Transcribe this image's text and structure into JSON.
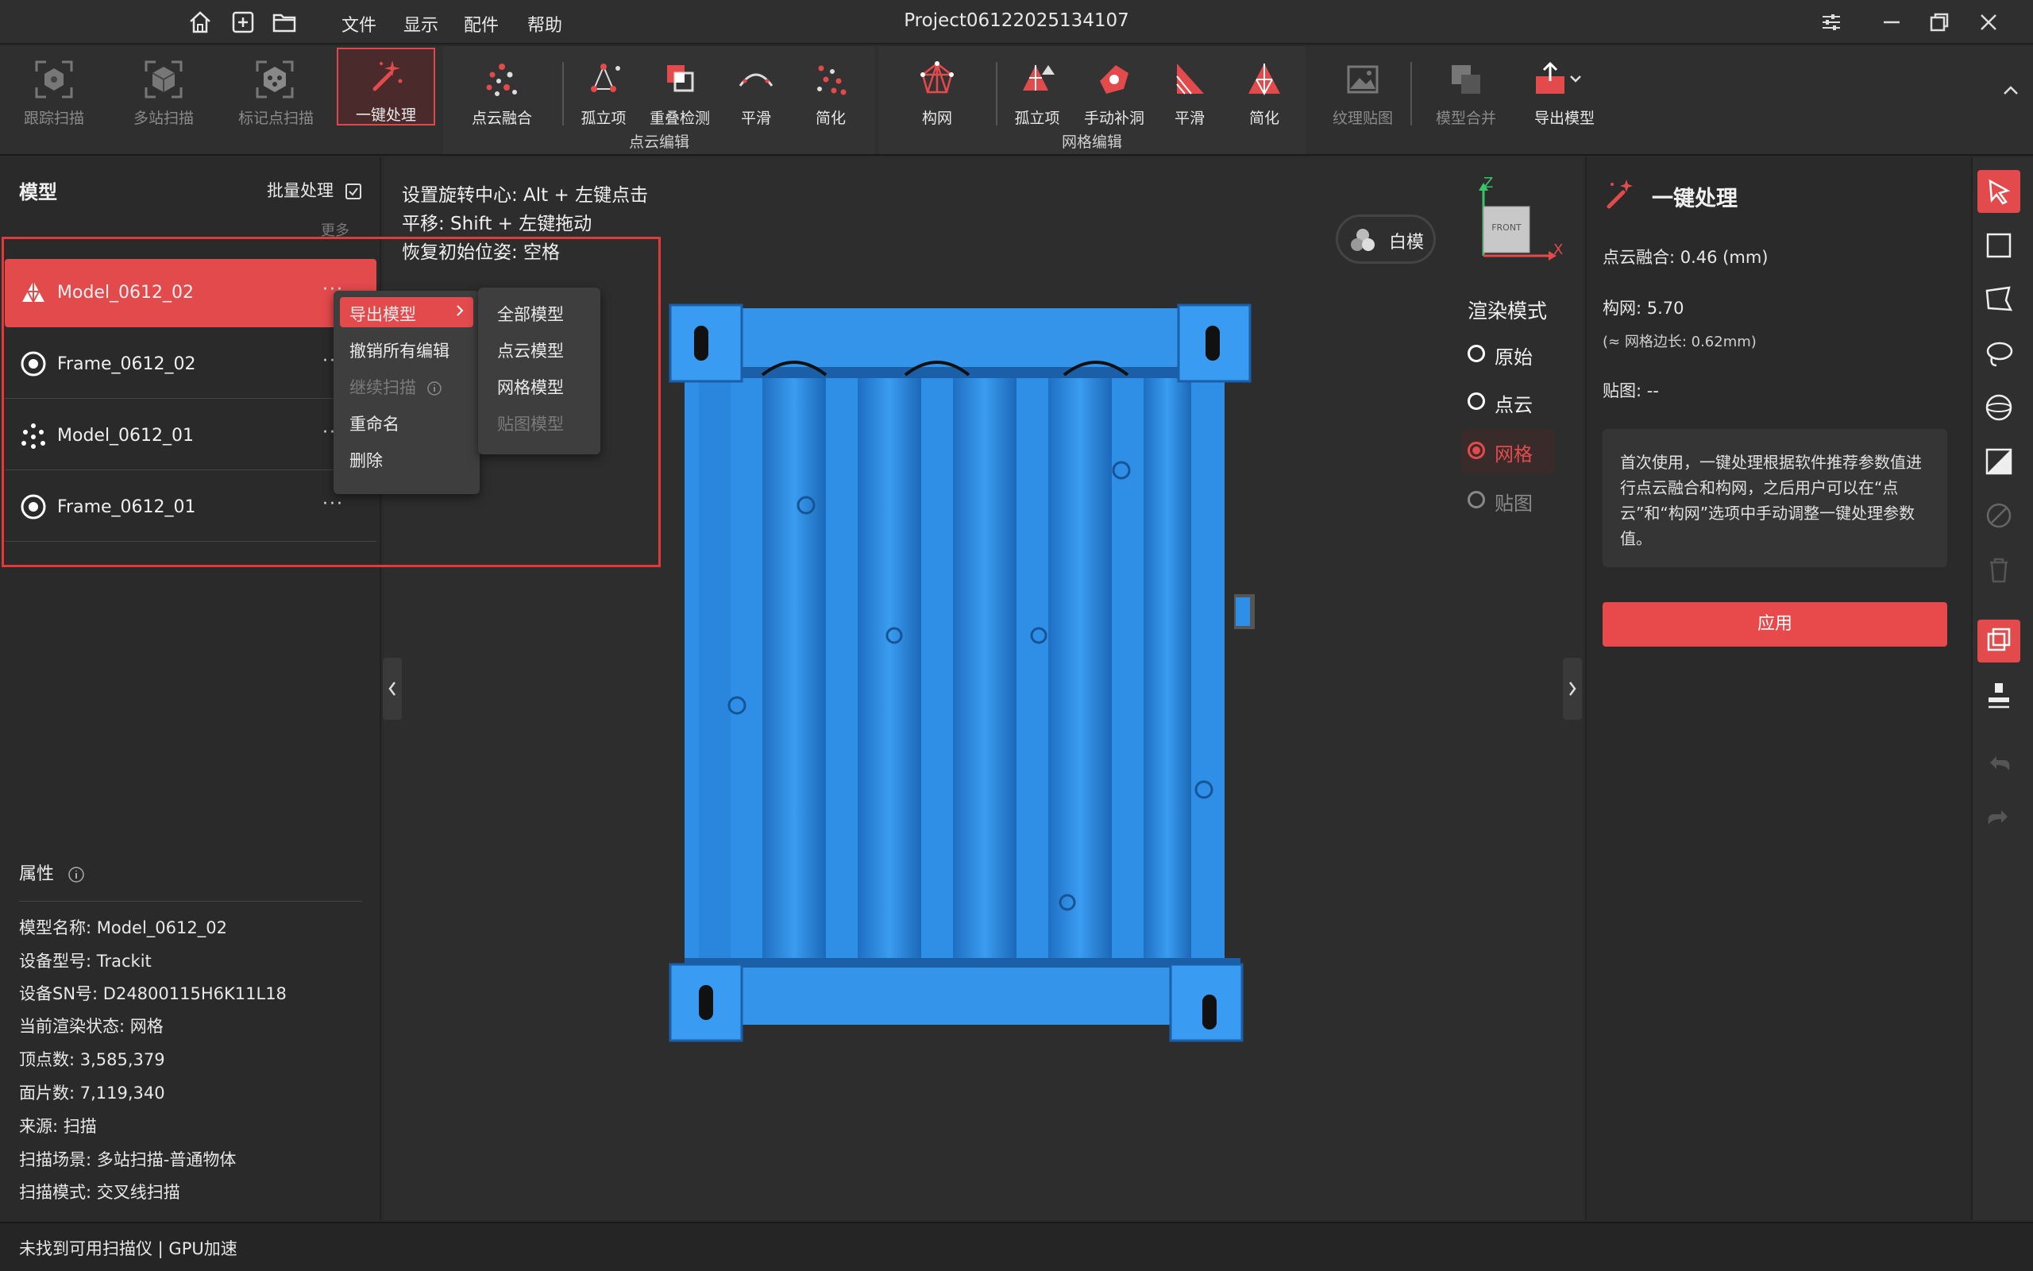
{
  "titlebar": {
    "project_title": "Project06122025134107",
    "menus": [
      "文件",
      "显示",
      "配件",
      "帮助"
    ]
  },
  "ribbon": {
    "scan": [
      {
        "label": "跟踪扫描",
        "icon": "tracking-scan-icon"
      },
      {
        "label": "多站扫描",
        "icon": "multi-station-scan-icon"
      },
      {
        "label": "标记点扫描",
        "icon": "marker-scan-icon"
      }
    ],
    "one_click": {
      "label": "一键处理",
      "icon": "magic-wand-icon"
    },
    "point_cloud_group": {
      "label": "点云编辑",
      "items": [
        {
          "label": "点云融合",
          "icon": "point-fusion-icon"
        },
        {
          "label": "孤立项",
          "icon": "isolated-icon"
        },
        {
          "label": "重叠检测",
          "icon": "overlap-detect-icon"
        },
        {
          "label": "平滑",
          "icon": "smooth-icon"
        },
        {
          "label": "简化",
          "icon": "simplify-icon"
        }
      ]
    },
    "mesh_group": {
      "label": "网格编辑",
      "items": [
        {
          "label": "构网",
          "icon": "mesh-build-icon"
        },
        {
          "label": "孤立项",
          "icon": "mesh-isolated-icon"
        },
        {
          "label": "手动补洞",
          "icon": "fill-hole-icon"
        },
        {
          "label": "平滑",
          "icon": "mesh-smooth-icon"
        },
        {
          "label": "简化",
          "icon": "mesh-simplify-icon"
        }
      ]
    },
    "texture": {
      "label": "纹理贴图",
      "icon": "texture-map-icon"
    },
    "merge": {
      "label": "模型合并",
      "icon": "model-merge-icon"
    },
    "export": {
      "label": "导出模型",
      "icon": "export-model-icon"
    }
  },
  "left_panel": {
    "title": "模型",
    "batch_label": "批量处理",
    "more_label": "更多",
    "models": [
      {
        "name": "Model_0612_02",
        "icon": "mesh-model-icon",
        "selected": true
      },
      {
        "name": "Frame_0612_02",
        "icon": "frame-icon",
        "selected": false
      },
      {
        "name": "Model_0612_01",
        "icon": "point-cloud-icon",
        "selected": false
      },
      {
        "name": "Frame_0612_01",
        "icon": "frame-icon",
        "selected": false
      }
    ],
    "more_dots": "···"
  },
  "context_menu": {
    "items": [
      {
        "label": "导出模型",
        "highlighted": true,
        "disabled": false
      },
      {
        "label": "撤销所有编辑",
        "highlighted": false,
        "disabled": false
      },
      {
        "label": "继续扫描",
        "highlighted": false,
        "disabled": true
      },
      {
        "label": "重命名",
        "highlighted": false,
        "disabled": false
      },
      {
        "label": "删除",
        "highlighted": false,
        "disabled": false
      }
    ],
    "submenu": [
      {
        "label": "全部模型",
        "disabled": false
      },
      {
        "label": "点云模型",
        "disabled": false
      },
      {
        "label": "网格模型",
        "disabled": false
      },
      {
        "label": "贴图模型",
        "disabled": true
      }
    ]
  },
  "properties": {
    "title": "属性",
    "rows": [
      "模型名称:  Model_0612_02",
      "设备型号:  Trackit",
      "设备SN号:  D24800115H6K11L18",
      "当前渲染状态:  网格",
      "顶点数:  3,585,379",
      "面片数:  7,119,340",
      "来源:  扫描",
      "扫描场景:  多站扫描-普通物体",
      "扫描模式:  交叉线扫描"
    ]
  },
  "viewport": {
    "hints": [
      "设置旋转中心: Alt + 左键点击",
      "平移: Shift + 左键拖动",
      "恢复初始位姿: 空格"
    ],
    "white_model_label": "白模",
    "axis": {
      "z": "Z",
      "x": "X",
      "cube_label": "FRONT"
    },
    "render_mode_title": "渲染模式",
    "render_modes": [
      {
        "label": "原始",
        "state": "normal"
      },
      {
        "label": "点云",
        "state": "normal"
      },
      {
        "label": "网格",
        "state": "selected"
      },
      {
        "label": "贴图",
        "state": "disabled"
      }
    ],
    "model_color": "#2f8fe6"
  },
  "right_panel": {
    "title": "一键处理",
    "point_fusion": "点云融合:  0.46 (mm)",
    "mesh": "构网:  5.70",
    "mesh_edge": "(≈ 网格边长: 0.62mm)",
    "texture": "贴图: --",
    "info": "首次使用，一键处理根据软件推荐参数值进行点云融合和构网，之后用户可以在“点云”和“构网”选项中手动调整一键处理参数值。",
    "apply_label": "应用"
  },
  "status_bar": {
    "text": "未找到可用扫描仪 | GPU加速"
  },
  "colors": {
    "accent": "#e34a4c",
    "background": "#2a2a2a",
    "model_blue": "#2f8fe6"
  }
}
